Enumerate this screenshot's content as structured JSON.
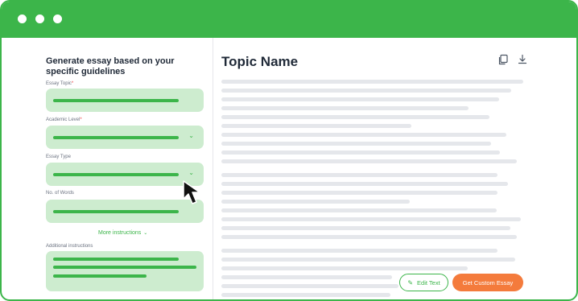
{
  "window": {
    "accent_color": "#3cb54a",
    "controls": [
      "dot",
      "dot",
      "dot"
    ]
  },
  "form": {
    "heading": "Generate essay based on your specific guidelines",
    "fields": [
      {
        "label": "Essay Topic",
        "required": true,
        "type": "text"
      },
      {
        "label": "Academic Level",
        "required": true,
        "type": "select"
      },
      {
        "label": "Essay Type",
        "required": false,
        "type": "select"
      },
      {
        "label": "No. of Words",
        "required": false,
        "type": "text"
      },
      {
        "label": "Additional instructions",
        "required": false,
        "type": "textarea"
      }
    ],
    "required_mark": "*",
    "more_instructions": "More instructions",
    "field_bg_color": "#cdeccf"
  },
  "output": {
    "title": "Topic Name",
    "icons": [
      "copy-icon",
      "download-icon"
    ]
  },
  "actions": {
    "edit_label": "Edit Text",
    "get_label": "Get Custom Essay",
    "get_color": "#f47b3c"
  }
}
